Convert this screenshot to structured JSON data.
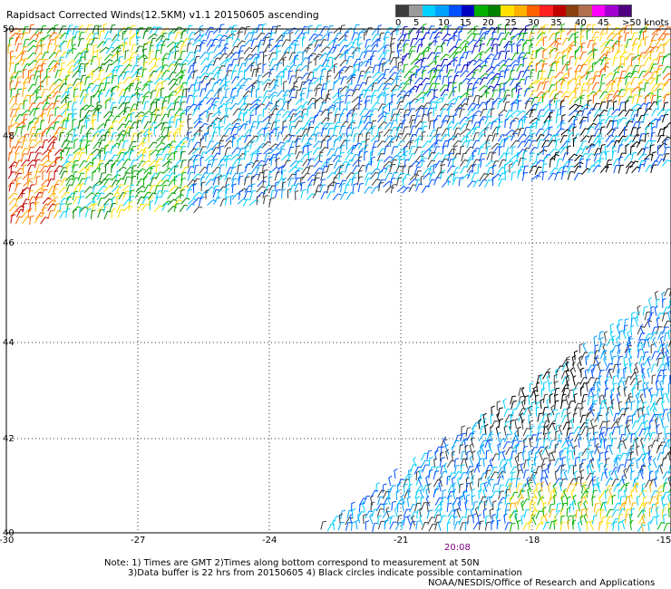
{
  "title": "Rapidsact Corrected Winds(12.5KM) v1.1 20150605 ascending",
  "legend": {
    "colors": [
      "#3c3c3c",
      "#9a9a9a",
      "#00d0ff",
      "#00a0ff",
      "#0050ff",
      "#0000c0",
      "#00b000",
      "#008000",
      "#ffe000",
      "#ffb000",
      "#ff6000",
      "#ff2020",
      "#c00000",
      "#8b4010",
      "#b07050",
      "#ff00ff",
      "#a000d0",
      "#500080"
    ],
    "labels": [
      "0",
      "5",
      "10",
      "15",
      "20",
      "25",
      "30",
      "35",
      "40",
      "45",
      ">50 knots"
    ],
    "unit": "knots"
  },
  "axes": {
    "lat_labels": [
      "50",
      "48",
      "46",
      "44",
      "42",
      "40"
    ],
    "lon_labels": [
      "-30",
      "-27",
      "-24",
      "-21",
      "-18",
      "-15"
    ]
  },
  "time_label": "20:08",
  "notes": {
    "line1": "Note: 1) Times are GMT 2)Times along bottom correspond to measurement at 50N",
    "line2": "3)Data buffer is 22 hrs from 20150605 4) Black circles indicate possible contamination"
  },
  "credit": "NOAA/NESDIS/Office of Research and Applications"
}
